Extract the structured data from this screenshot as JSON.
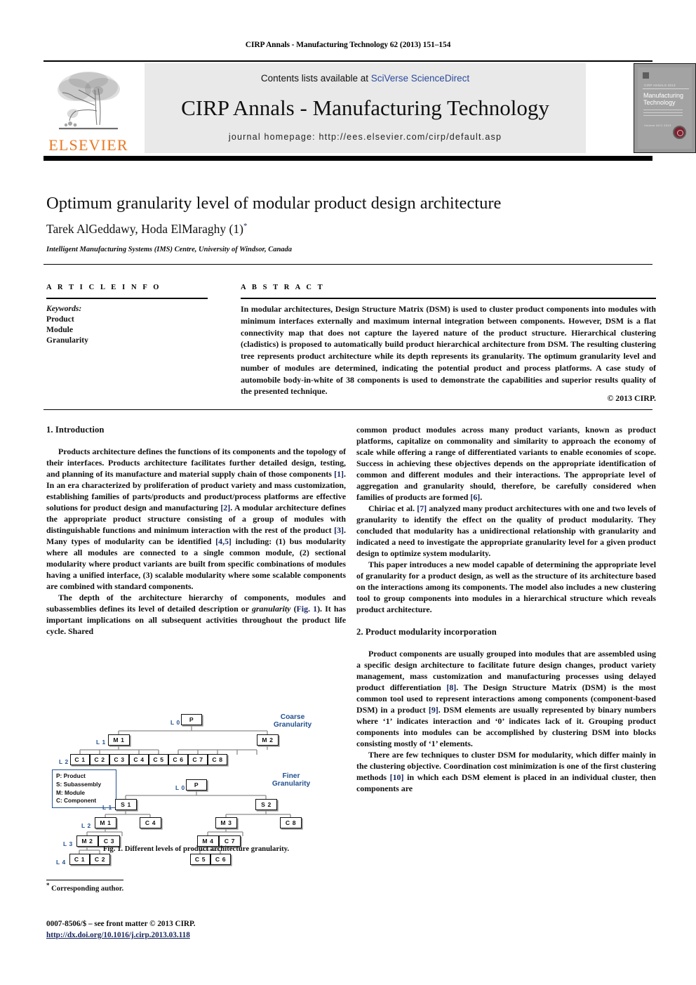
{
  "running_head": "CIRP Annals - Manufacturing Technology 62 (2013) 151–154",
  "masthead": {
    "contents_prefix": "Contents lists available at ",
    "contents_link": "SciVerse ScienceDirect",
    "journal_title": "CIRP Annals - Manufacturing Technology",
    "homepage": "journal homepage: http://ees.elsevier.com/cirp/default.asp",
    "publisher_logo_word": "ELSEVIER",
    "publisher_logo_color": "#E87722",
    "link_color": "#2b4a9b",
    "cover": {
      "series": "CIRP ANNALS 2013",
      "title_line1": "Manufacturing",
      "title_line2": "Technology",
      "small_text": "Volume 62/1 2013"
    }
  },
  "article": {
    "title": "Optimum granularity level of modular product design architecture",
    "authors": "Tarek AlGeddawy, Hoda ElMaraghy (1)",
    "author_marker": "*",
    "affiliation": "Intelligent Manufacturing Systems (IMS) Centre, University of Windsor, Canada"
  },
  "article_info": {
    "heading": "A R T I C L E   I N F O",
    "keywords_label": "Keywords:",
    "keywords": [
      "Product",
      "Module",
      "Granularity"
    ]
  },
  "abstract": {
    "heading": "A B S T R A C T",
    "text": "In modular architectures, Design Structure Matrix (DSM) is used to cluster product components into modules with minimum interfaces externally and maximum internal integration between components. However, DSM is a flat connectivity map that does not capture the layered nature of the product structure. Hierarchical clustering (cladistics) is proposed to automatically build product hierarchical architecture from DSM. The resulting clustering tree represents product architecture while its depth represents its granularity. The optimum granularity level and number of modules are determined, indicating the potential product and process platforms. A case study of automobile body-in-white of 38 components is used to demonstrate the capabilities and superior results quality of the presented technique.",
    "copyright": "© 2013 CIRP."
  },
  "body": {
    "section1_heading": "1.  Introduction",
    "section2_heading": "2.  Product modularity incorporation",
    "left_p1_a": "Products architecture defines the functions of its components and the topology of their interfaces. Products architecture facilitates further detailed design, testing, and planning of its manufacture and material supply chain of those components ",
    "left_p1_r1": "[1]",
    "left_p1_b": ". In an era characterized by proliferation of product variety and mass customization, establishing families of parts/products and product/process platforms are effective solutions for product design and manufacturing ",
    "left_p1_r2": "[2]",
    "left_p1_c": ". A modular architecture defines the appropriate product structure consisting of a group of modules with distinguishable functions and minimum interaction with the rest of the product ",
    "left_p1_r3": "[3]",
    "left_p1_d": ". Many types of modularity can be identified ",
    "left_p1_r4": "[4,5]",
    "left_p1_e": " including: (1) bus modularity where all modules are connected to a single common module, (2) sectional modularity where product variants are built from specific combinations of modules having a unified interface, (3) scalable modularity where some scalable components are combined with standard components.",
    "left_p2_a": "The depth of the architecture hierarchy of components, modules and subassemblies defines its level of detailed description or ",
    "left_p2_ital": "granularity",
    "left_p2_b": " (",
    "left_p2_r1": "Fig. 1",
    "left_p2_c": "). It has important implications on all subsequent activities throughout the product life cycle. Shared",
    "right_p1_a": "common product modules across many product variants, known as product platforms, capitalize on commonality and similarity to approach the economy of scale while offering a range of differentiated variants to enable economies of scope. Success in achieving these objectives depends on the appropriate identification of common and different modules and their interactions. The appropriate level of aggregation and granularity should, therefore, be carefully considered when families of products are formed ",
    "right_p1_r1": "[6]",
    "right_p1_b": ".",
    "right_p2_a": "Chiriac et al. ",
    "right_p2_r1": "[7]",
    "right_p2_b": " analyzed many product architectures with one and two levels of granularity to identify the effect on the quality of product modularity. They concluded that modularity has a unidirectional relationship with granularity and indicated a need to investigate the appropriate granularity level for a given product design to optimize system modularity.",
    "right_p3": "This paper introduces a new model capable of determining the appropriate level of granularity for a product design, as well as the structure of its architecture based on the interactions among its components. The model also includes a new clustering tool to group components into modules in a hierarchical structure which reveals product architecture.",
    "right_p4_a": "Product components are usually grouped into modules that are assembled using a specific design architecture to facilitate future design changes, product variety management, mass customization and manufacturing processes using delayed product differentiation ",
    "right_p4_r1": "[8]",
    "right_p4_b": ". The Design Structure Matrix (DSM) is the most common tool used to represent interactions among components (component-based DSM) in a product ",
    "right_p4_r2": "[9]",
    "right_p4_c": ". DSM elements are usually represented by binary numbers where ‘1’ indicates interaction and ‘0’ indicates lack of it. Grouping product components into modules can be accomplished by clustering DSM into blocks consisting mostly of ‘1’ elements.",
    "right_p5_a": "There are few techniques to cluster DSM for modularity, which differ mainly in the clustering objective. Coordination cost minimization is one of the first clustering methods ",
    "right_p5_r1": "[10]",
    "right_p5_b": " in which each DSM element is placed in an individual cluster, then components are"
  },
  "figure": {
    "caption": "Fig. 1. Different levels of product architecture granularity.",
    "coarse_label_l1": "Coarse",
    "coarse_label_l2": "Granularity",
    "finer_label_l1": "Finer",
    "finer_label_l2": "Granularity",
    "label_color": "#24518f",
    "legend": [
      "P: Product",
      "S: Subassembly",
      "M: Module",
      "C: Component"
    ],
    "coarse_tree": {
      "levels": [
        "L 0",
        "L 1",
        "L 2"
      ],
      "l0_nodes": [
        "P"
      ],
      "l1_nodes": [
        "M 1",
        "M 2"
      ],
      "l2_nodes": [
        "C 1",
        "C 2",
        "C 3",
        "C 4",
        "C 5",
        "C 6",
        "C 7",
        "C 8"
      ]
    },
    "finer_tree": {
      "levels": [
        "L 0",
        "L 1",
        "L 2",
        "L 3",
        "L 4"
      ],
      "l0_nodes": [
        "P"
      ],
      "l1_nodes": [
        "S 1",
        "S 2"
      ],
      "l2_nodes": [
        "M 1",
        "C 4",
        "M 3",
        "C 8"
      ],
      "l3_nodes": [
        "M 2",
        "C 3",
        "M 4",
        "C 7"
      ],
      "l4_nodes": [
        "C 1",
        "C 2",
        "C 5",
        "C 6"
      ]
    }
  },
  "footer": {
    "corresponding_marker": "*",
    "corresponding": "Corresponding author.",
    "issn_line": "0007-8506/$ – see front matter © 2013 CIRP.",
    "doi_line": "http://dx.doi.org/10.1016/j.cirp.2013.03.118"
  }
}
